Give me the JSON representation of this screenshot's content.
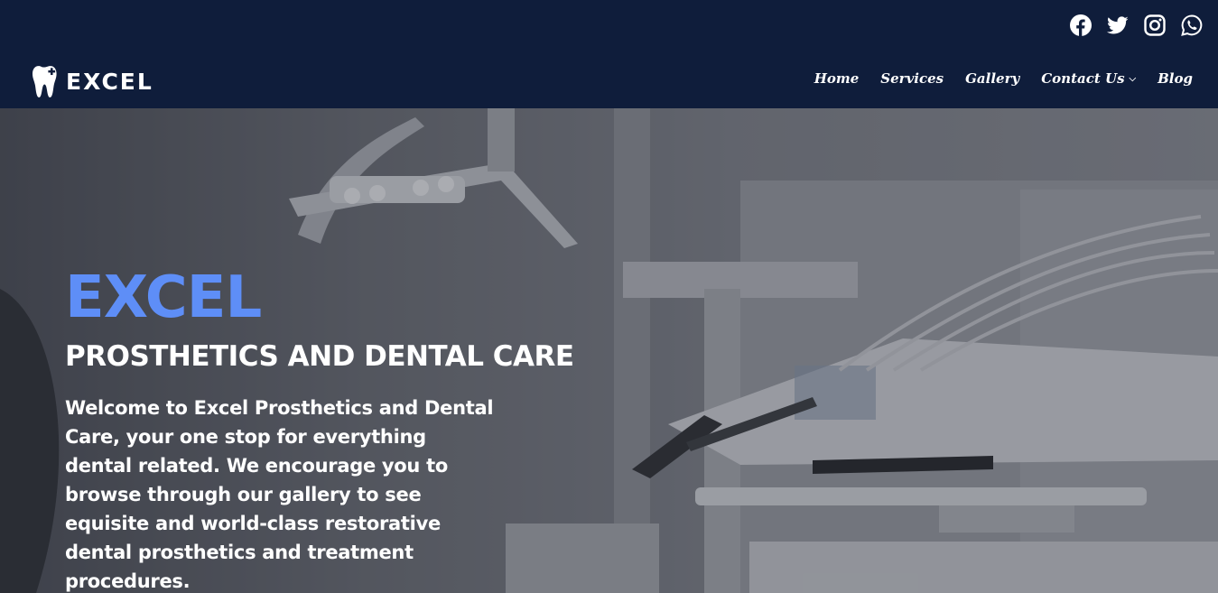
{
  "header": {
    "logo_text": "EXCEL",
    "social": [
      {
        "icon": "facebook-icon",
        "label": "Facebook"
      },
      {
        "icon": "twitter-icon",
        "label": "Twitter"
      },
      {
        "icon": "instagram-icon",
        "label": "Instagram"
      },
      {
        "icon": "whatsapp-icon",
        "label": "WhatsApp"
      }
    ],
    "nav": [
      {
        "label": "Home"
      },
      {
        "label": "Services"
      },
      {
        "label": "Gallery"
      },
      {
        "label": "Contact Us",
        "has_dropdown": true
      },
      {
        "label": "Blog"
      }
    ]
  },
  "hero": {
    "brand": "EXCEL",
    "subtitle": "PROSTHETICS AND DENTAL CARE",
    "welcome": "Welcome to Excel Prosthetics and Dental Care, your one stop for everything dental related. We encourage you to browse through our gallery to see equisite and world-class restorative dental prosthetics and treatment procedures."
  },
  "colors": {
    "header_bg": "#0f1d3b",
    "brand_accent": "#5e8ef7",
    "text": "#ffffff"
  }
}
